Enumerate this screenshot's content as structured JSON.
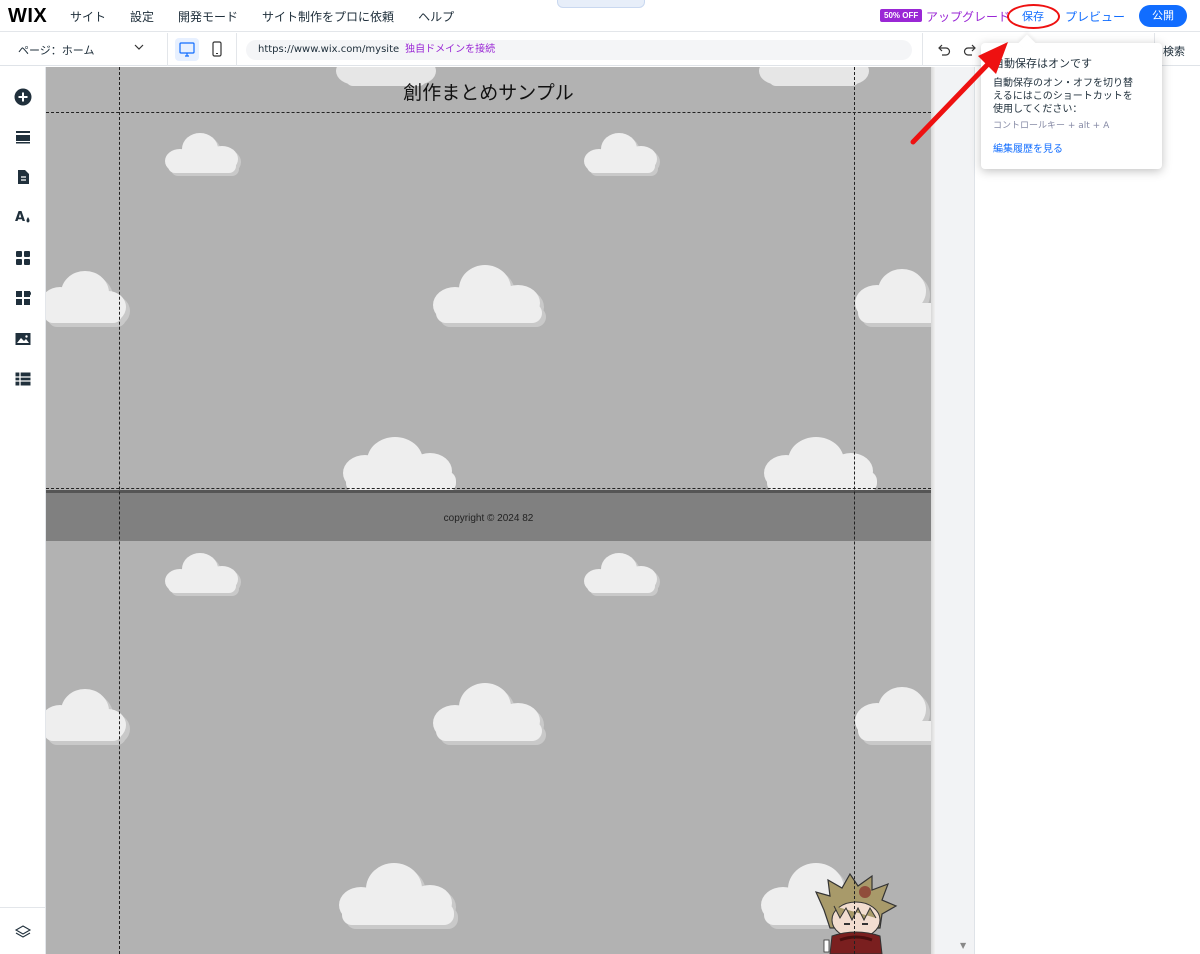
{
  "topbar": {
    "logo": "WIX",
    "menu": [
      "サイト",
      "設定",
      "開発モード",
      "サイト制作をプロに依頼",
      "ヘルプ"
    ],
    "collapse_handle": "˄",
    "discount_badge": "50% OFF",
    "upgrade_label": "アップグレード",
    "save_label": "保存",
    "preview_label": "プレビュー",
    "publish_label": "公開"
  },
  "toolbar2": {
    "page_label": "ページ：ホーム",
    "url": "https://www.wix.com/mysite",
    "connect_domain": "独自ドメインを接続",
    "search_label": "検索"
  },
  "left_tools": [
    "add-icon",
    "sections-icon",
    "pages-icon",
    "theme-icon",
    "apps-icon",
    "business-apps-icon",
    "media-icon",
    "cms-icon",
    "layers-icon"
  ],
  "canvas": {
    "site_title": "創作まとめサンプル",
    "footer_text": "copyright © 2024 82",
    "background_color": "#b2b2b2",
    "footer_color": "#808080"
  },
  "autosave_popup": {
    "title": "自動保存はオンです",
    "body_line1": "自動保存のオン・オフを切り替",
    "body_line2": "えるにはこのショートカットを",
    "body_line3": "使用してください：",
    "shortcut": "コントロールキー + alt + A",
    "history_link": "編集履歴を見る"
  },
  "colors": {
    "accent": "#116dff",
    "upgrade": "#9a27d5",
    "annotation": "#ee1111"
  }
}
